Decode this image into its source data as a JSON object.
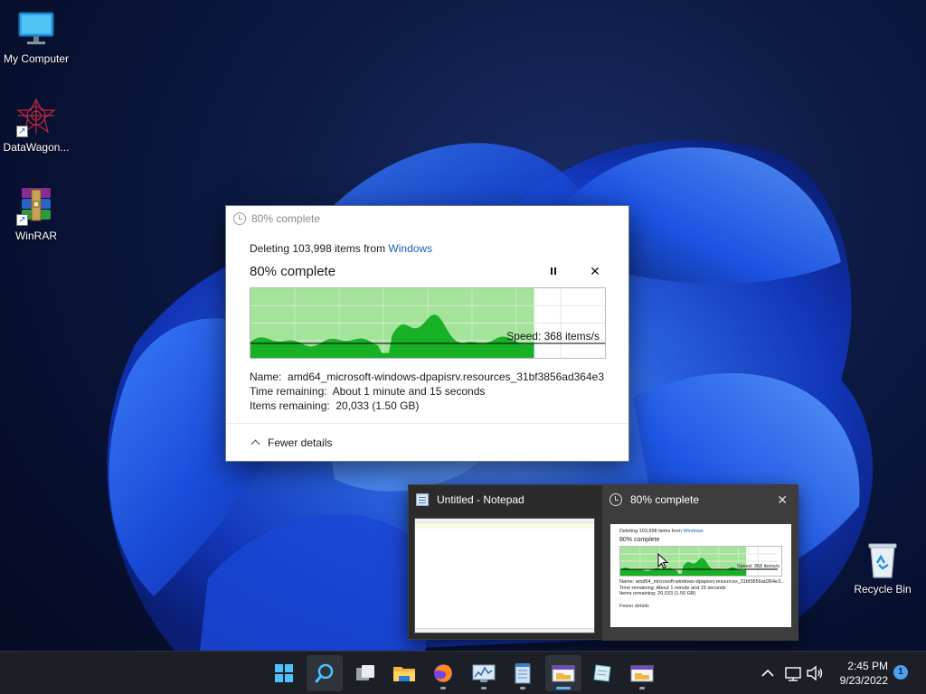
{
  "desktop_icons": [
    {
      "label": "My Computer",
      "icon": "monitor-icon"
    },
    {
      "label": "DataWagon...",
      "icon": "datawagon-icon"
    },
    {
      "label": "WinRAR",
      "icon": "winrar-icon"
    },
    {
      "label": "Recycle Bin",
      "icon": "recycle-bin-icon"
    }
  ],
  "dialog": {
    "title": "80% complete",
    "deleting_prefix": "Deleting 103,998 items from ",
    "deleting_location": "Windows",
    "percent_label": "80% complete",
    "progress_fraction": 0.8,
    "speed": "Speed: 368 items/s",
    "name_label": "Name:",
    "name_value": "amd64_microsoft-windows-dpapisrv.resources_31bf3856ad364e3...",
    "time_label": "Time remaining:",
    "time_value": "About 1 minute and 15 seconds",
    "items_label": "Items remaining:",
    "items_value": "20,033 (1.50 GB)",
    "fewer_details": "Fewer details"
  },
  "flyout": {
    "notepad_title": "Untitled - Notepad",
    "progress_title": "80% complete",
    "mini": {
      "deleting_prefix": "Deleting 103,998 items from ",
      "deleting_location": "Windows",
      "percent_label": "80% complete",
      "speed": "Speed: 368 items/s",
      "name_line": "Name: amd64_microsoft-windows-dpapisrv.resources_31bf3856ad364e3...",
      "time_line": "Time remaining: About 1 minute and 15 seconds",
      "items_line": "Items remaining: 20,033 (1.50 GB)",
      "fewer_details": "Fewer details"
    }
  },
  "taskbar": {
    "apps": [
      "start-icon",
      "search-icon",
      "task-view-icon",
      "file-explorer-icon",
      "firefox-icon",
      "resource-monitor-icon",
      "notepad-icon",
      "file-progress-icon",
      "paper-icon",
      "file-progress-icon"
    ],
    "time": "2:45 PM",
    "date": "9/23/2022",
    "notification_count": "1"
  },
  "colors": {
    "progress_fill": "#a3e39a",
    "speed_area": "#18b025",
    "taskbar_bg": "#1c1f26",
    "accent": "#4aa3f0"
  }
}
